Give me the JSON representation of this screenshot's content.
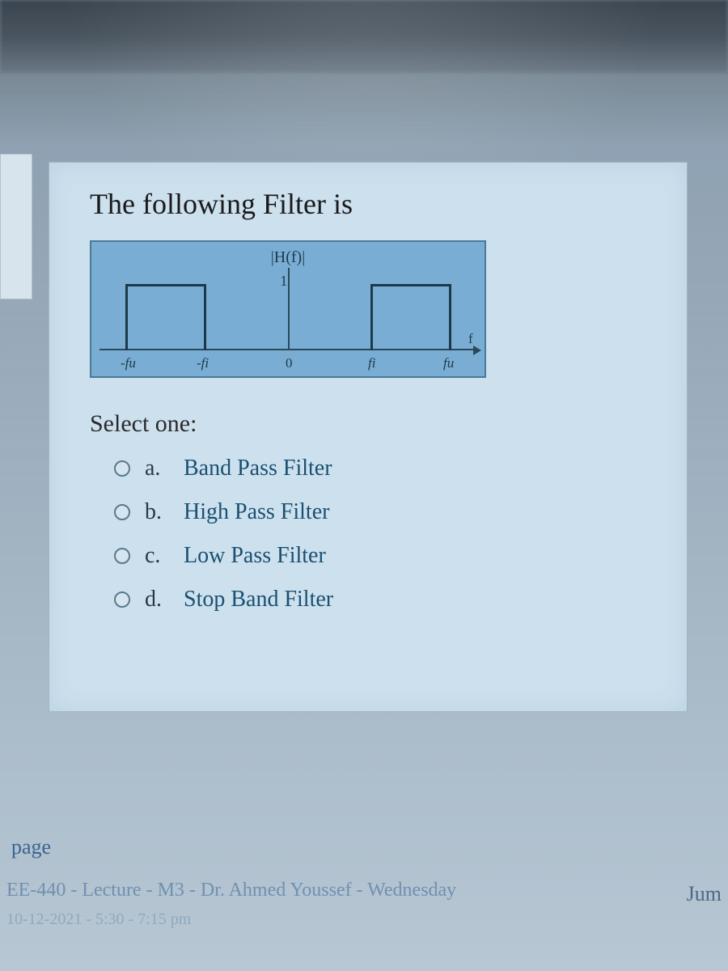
{
  "question": {
    "title": "The following Filter is",
    "diagram": {
      "ylabel": "|H(f)|",
      "ytick": "1",
      "xlabels": [
        "-fu",
        "-fi",
        "0",
        "fi",
        "fu",
        "f"
      ]
    },
    "selectLabel": "Select one:",
    "options": [
      {
        "letter": "a.",
        "text": "Band Pass Filter"
      },
      {
        "letter": "b.",
        "text": "High Pass Filter"
      },
      {
        "letter": "c.",
        "text": "Low Pass Filter"
      },
      {
        "letter": "d.",
        "text": "Stop Band Filter"
      }
    ]
  },
  "nav": {
    "pageLink": "page"
  },
  "footer": {
    "line1": "EE-440 - Lecture - M3 - Dr. Ahmed Youssef - Wednesday",
    "line2": "10-12-2021 - 5:30 - 7:15 pm",
    "jump": "Jum"
  }
}
